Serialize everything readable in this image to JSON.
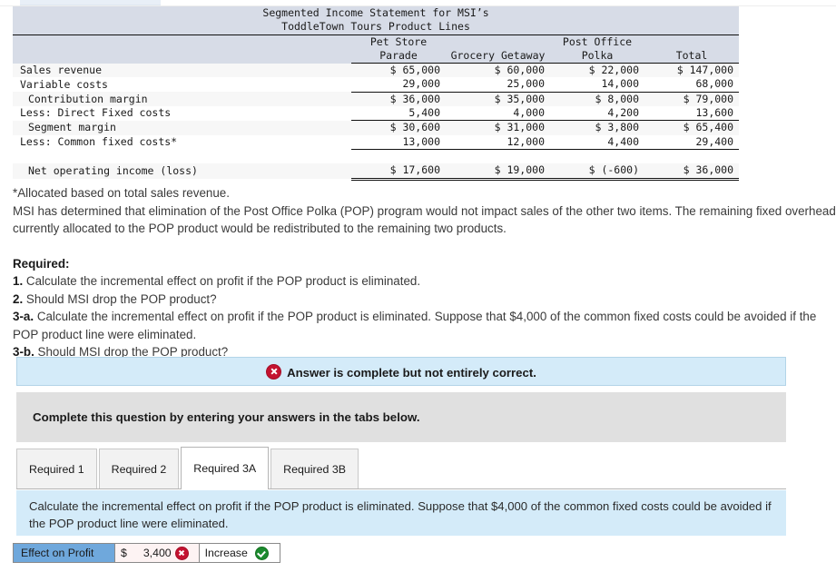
{
  "statement": {
    "title_line1": "Segmented Income Statement for MSI’s",
    "title_line2": "ToddleTown Tours Product Lines",
    "column_group_headers": [
      "",
      "Pet Store",
      "",
      "Post Office",
      ""
    ],
    "columns": [
      "",
      "Parade",
      "Grocery Getaway",
      "Polka",
      "Total"
    ],
    "rows": [
      {
        "label": "Sales revenue",
        "values": [
          "$ 65,000",
          "$ 60,000",
          "$ 22,000",
          "$ 147,000"
        ]
      },
      {
        "label": "Variable costs",
        "values": [
          "29,000",
          "25,000",
          "14,000",
          "68,000"
        ]
      },
      {
        "label": "Contribution margin",
        "values": [
          "$ 36,000",
          "$ 35,000",
          "$ 8,000",
          "$ 79,000"
        ]
      },
      {
        "label": "Less: Direct Fixed costs",
        "values": [
          "5,400",
          "4,000",
          "4,200",
          "13,600"
        ]
      },
      {
        "label": "Segment margin",
        "values": [
          "$ 30,600",
          "$ 31,000",
          "$ 3,800",
          "$ 65,400"
        ]
      },
      {
        "label": "Less: Common fixed costs*",
        "values": [
          "13,000",
          "12,000",
          "4,400",
          "29,400"
        ]
      },
      {
        "label": "Net operating income (loss)",
        "values": [
          "$ 17,600",
          "$ 19,000",
          "$ (-600)",
          "$ 36,000"
        ]
      }
    ]
  },
  "prose": {
    "footnote": "*Allocated based on total sales revenue.",
    "paragraph": "MSI has determined that elimination of the Post Office Polka (POP) program would not impact sales of the other two items. The remaining fixed overhead currently allocated to the POP product would be redistributed to the remaining two products."
  },
  "required": {
    "heading": "Required:",
    "items": [
      {
        "num": "1.",
        "text": "Calculate the incremental effect on profit if the POP product is eliminated."
      },
      {
        "num": "2.",
        "text": "Should MSI drop the POP product?"
      },
      {
        "num": "3-a.",
        "text": "Calculate the incremental effect on profit if the POP product is eliminated. Suppose that $4,000 of the common fixed costs could be avoided if the POP product line were eliminated."
      },
      {
        "num": "3-b.",
        "text": "Should MSI drop the POP product?"
      }
    ]
  },
  "alert": {
    "icon": "error-circle-icon",
    "message": "Answer is complete but not entirely correct.",
    "background_color": "#d4ebf9",
    "icon_color": "#c41230"
  },
  "instruction_box": {
    "text": "Complete this question by entering your answers in the tabs below.",
    "background_color": "#e0e0e0"
  },
  "tabs": {
    "items": [
      {
        "label": "Required 1",
        "active": false
      },
      {
        "label": "Required 2",
        "active": false
      },
      {
        "label": "Required 3A",
        "active": true
      },
      {
        "label": "Required 3B",
        "active": false
      }
    ]
  },
  "tab_panel": {
    "text": "Calculate the incremental effect on profit if the POP product is eliminated. Suppose that $4,000 of the common fixed costs could be avoided if the POP product line were eliminated.",
    "background_color": "#d4ebf9"
  },
  "answer_row": {
    "label": "Effect on Profit",
    "label_color": "#6fa8dc",
    "currency": "$",
    "amount": "3,400",
    "amount_status": "incorrect",
    "direction": "Increase",
    "direction_status": "correct"
  }
}
